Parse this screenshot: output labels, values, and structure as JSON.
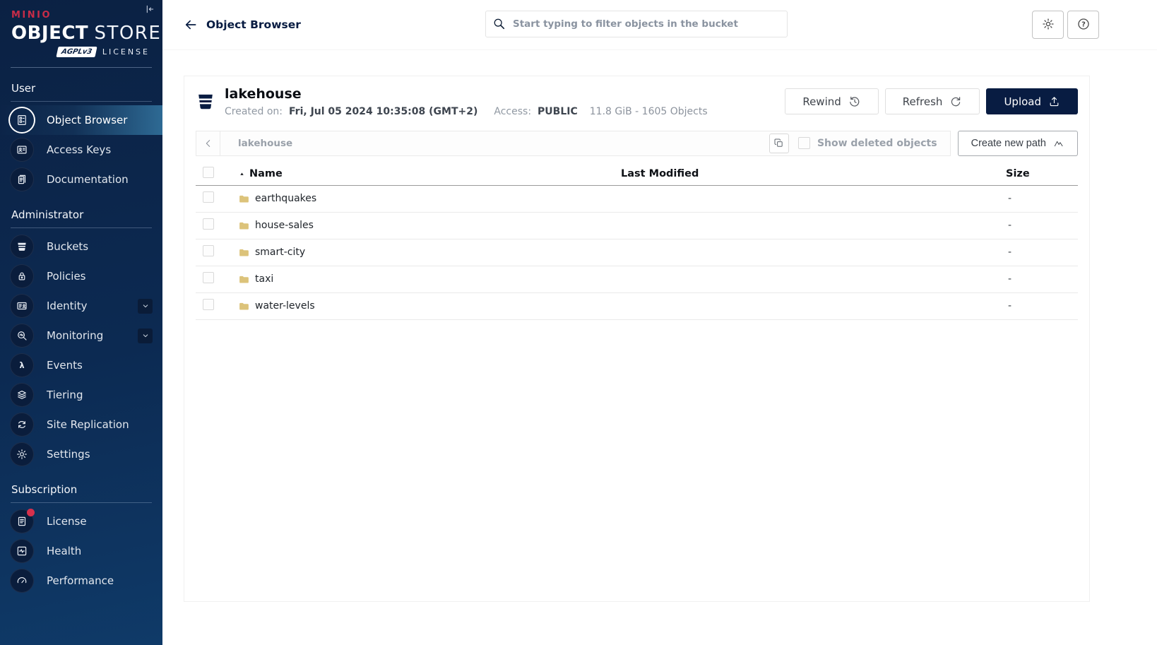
{
  "colors": {
    "navy": "#081C42",
    "brand_red": "#C72C48",
    "sidebar_active_gradient_end": "#2E6A94",
    "folder": "#DCC37A",
    "notification_red": "#D6304C"
  },
  "sidebar": {
    "collapse_icon": "collapse-sidebar-icon",
    "logo": {
      "brand": "MINIO",
      "product_bold": "OBJECT",
      "product_light": "STORE",
      "badge": "AGPLv3",
      "license": "LICENSE"
    },
    "sections": [
      {
        "label": "User",
        "items": [
          {
            "label": "Object Browser",
            "icon": "object-browser-icon",
            "active": true
          },
          {
            "label": "Access Keys",
            "icon": "access-keys-icon"
          },
          {
            "label": "Documentation",
            "icon": "documentation-icon"
          }
        ]
      },
      {
        "label": "Administrator",
        "items": [
          {
            "label": "Buckets",
            "icon": "buckets-icon"
          },
          {
            "label": "Policies",
            "icon": "policies-icon"
          },
          {
            "label": "Identity",
            "icon": "identity-icon",
            "expandable": true
          },
          {
            "label": "Monitoring",
            "icon": "monitoring-icon",
            "expandable": true
          },
          {
            "label": "Events",
            "icon": "events-icon"
          },
          {
            "label": "Tiering",
            "icon": "tiering-icon"
          },
          {
            "label": "Site Replication",
            "icon": "site-replication-icon"
          },
          {
            "label": "Settings",
            "icon": "settings-icon"
          }
        ]
      },
      {
        "label": "Subscription",
        "items": [
          {
            "label": "License",
            "icon": "license-icon",
            "notification": true
          },
          {
            "label": "Health",
            "icon": "health-icon"
          },
          {
            "label": "Performance",
            "icon": "performance-icon"
          }
        ]
      }
    ]
  },
  "topbar": {
    "back_icon": "back-arrow-icon",
    "title": "Object Browser",
    "search": {
      "icon": "search-icon",
      "placeholder": "Start typing to filter objects in the bucket",
      "value": ""
    },
    "actions": [
      {
        "icon": "gear-icon"
      },
      {
        "icon": "help-icon"
      }
    ]
  },
  "bucket_header": {
    "bucket_icon": "bucket-icon",
    "name": "lakehouse",
    "created_label": "Created on:",
    "created_value": "Fri, Jul 05 2024 10:35:08 (GMT+2)",
    "access_label": "Access:",
    "access_value": "PUBLIC",
    "usage": "11.8 GiB - 1605 Objects",
    "rewind_label": "Rewind",
    "rewind_icon": "rewind-icon",
    "refresh_label": "Refresh",
    "refresh_icon": "refresh-icon",
    "upload_label": "Upload",
    "upload_icon": "upload-icon"
  },
  "browser": {
    "back_icon": "chevron-left-icon",
    "current_path": "lakehouse",
    "copy_icon": "copy-path-icon",
    "show_deleted": {
      "label": "Show deleted objects",
      "checked": false
    },
    "create_path_label": "Create new path",
    "create_path_icon": "new-path-icon",
    "table": {
      "sort_icon": "sort-asc-icon",
      "columns": [
        "Name",
        "Last Modified",
        "Size"
      ],
      "rows": [
        {
          "icon": "folder-icon",
          "name": "earthquakes",
          "last_modified": "",
          "size": "-"
        },
        {
          "icon": "folder-icon",
          "name": "house-sales",
          "last_modified": "",
          "size": "-"
        },
        {
          "icon": "folder-icon",
          "name": "smart-city",
          "last_modified": "",
          "size": "-"
        },
        {
          "icon": "folder-icon",
          "name": "taxi",
          "last_modified": "",
          "size": "-"
        },
        {
          "icon": "folder-icon",
          "name": "water-levels",
          "last_modified": "",
          "size": "-"
        }
      ]
    }
  }
}
